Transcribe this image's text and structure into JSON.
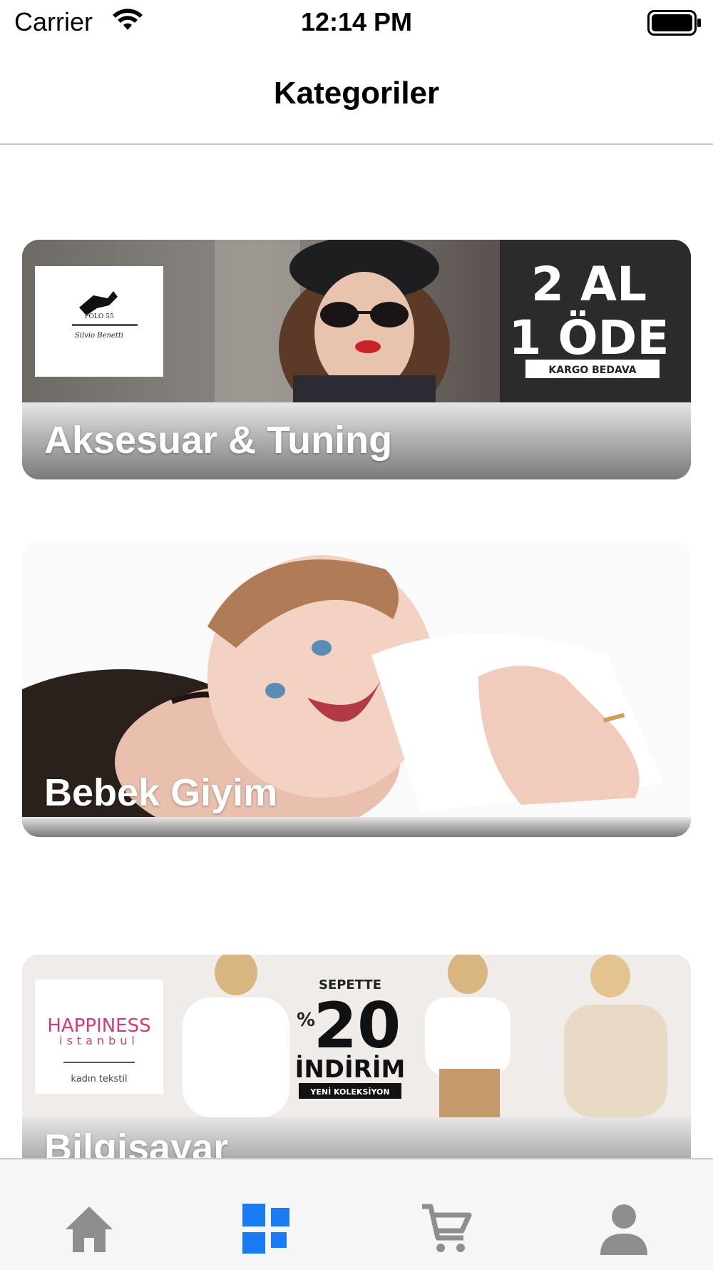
{
  "status_bar": {
    "carrier": "Carrier",
    "time": "12:14 PM"
  },
  "nav": {
    "title": "Kategoriler"
  },
  "categories": [
    {
      "label": "Aksesuar & Tuning",
      "banner": {
        "brand_logo": "POLO 55 Silvio Benetti",
        "promo_line1": "2 AL",
        "promo_line2": "1 ÖDE",
        "promo_tag": "KARGO BEDAVA"
      }
    },
    {
      "label": "Bebek Giyim",
      "banner": {}
    },
    {
      "label": "Bilgisayar",
      "banner": {
        "brand_logo": "HAPPINESS istanbul",
        "brand_sub": "kadın tekstil",
        "promo_top": "SEPETTE",
        "promo_pct": "%",
        "promo_value": "20",
        "promo_word": "İNDİRİM",
        "promo_tag": "YENİ KOLEKSİYON"
      }
    }
  ],
  "tab_bar": {
    "items": [
      {
        "icon": "home-icon",
        "active": false
      },
      {
        "icon": "grid-icon",
        "active": true
      },
      {
        "icon": "cart-icon",
        "active": false
      },
      {
        "icon": "person-icon",
        "active": false
      }
    ],
    "active_color": "#1a7cf5",
    "inactive_color": "#8e8e8e"
  }
}
